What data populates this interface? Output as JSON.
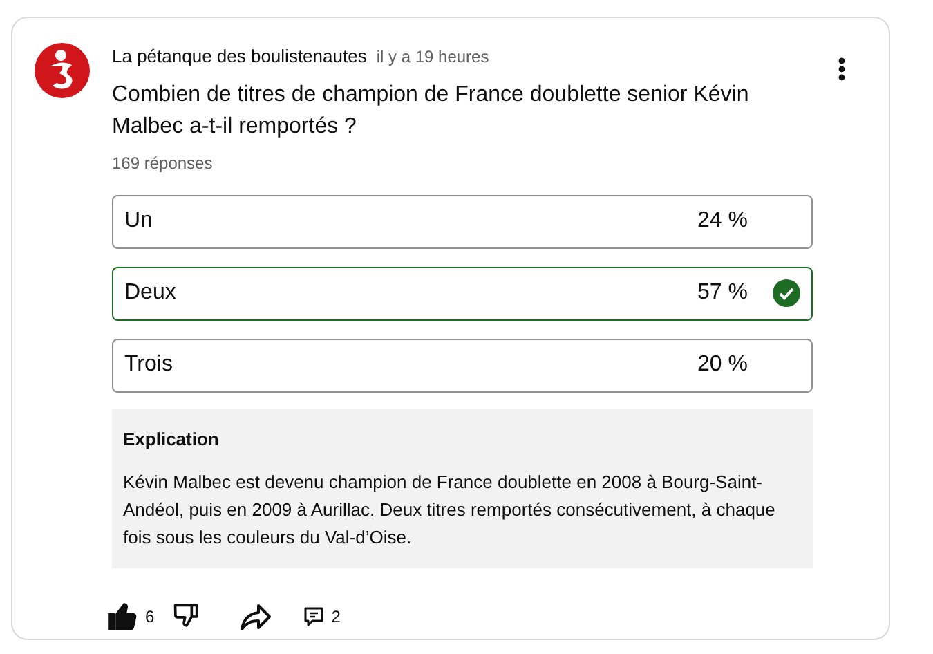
{
  "post": {
    "author": "La pétanque des boulistenautes",
    "time": "il y a 19 heures",
    "question": "Combien de titres de champion de France doublette senior Kévin Malbec a-t-il remportés ?",
    "responses": "169 réponses",
    "options": [
      {
        "label": "Un",
        "percent": "24 %",
        "correct": false
      },
      {
        "label": "Deux",
        "percent": "57 %",
        "correct": true
      },
      {
        "label": "Trois",
        "percent": "20 %",
        "correct": false
      }
    ],
    "explanation": {
      "title": "Explication",
      "text": "Kévin Malbec est devenu champion de France doublette en 2008 à Bourg-Saint-Andéol, puis en 2009 à Aurillac. Deux titres remportés consécutivement, à chaque fois sous les couleurs du Val-d’Oise."
    },
    "actions": {
      "liked": true,
      "likes": "6",
      "comments": "2"
    }
  }
}
